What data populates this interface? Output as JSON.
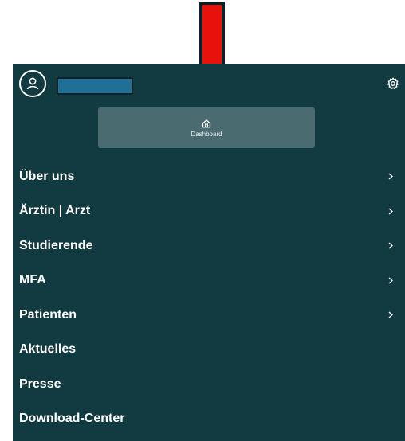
{
  "header": {
    "user_name": "",
    "avatar_icon": "user-circle-icon",
    "settings_icon": "gear-icon"
  },
  "dashboard": {
    "label": "Dashboard",
    "icon": "home-icon"
  },
  "menu": {
    "items": [
      {
        "label": "Über uns",
        "has_submenu": true
      },
      {
        "label": "Ärztin | Arzt",
        "has_submenu": true
      },
      {
        "label": "Studierende",
        "has_submenu": true
      },
      {
        "label": "MFA",
        "has_submenu": true
      },
      {
        "label": "Patienten",
        "has_submenu": true
      },
      {
        "label": "Aktuelles",
        "has_submenu": false
      },
      {
        "label": "Presse",
        "has_submenu": false
      },
      {
        "label": "Download-Center",
        "has_submenu": false
      }
    ]
  },
  "colors": {
    "panel_bg": "#123a41",
    "dashboard_bg": "#4a6c71",
    "name_box": "#1f6f96",
    "arrow": "#e8120c"
  }
}
